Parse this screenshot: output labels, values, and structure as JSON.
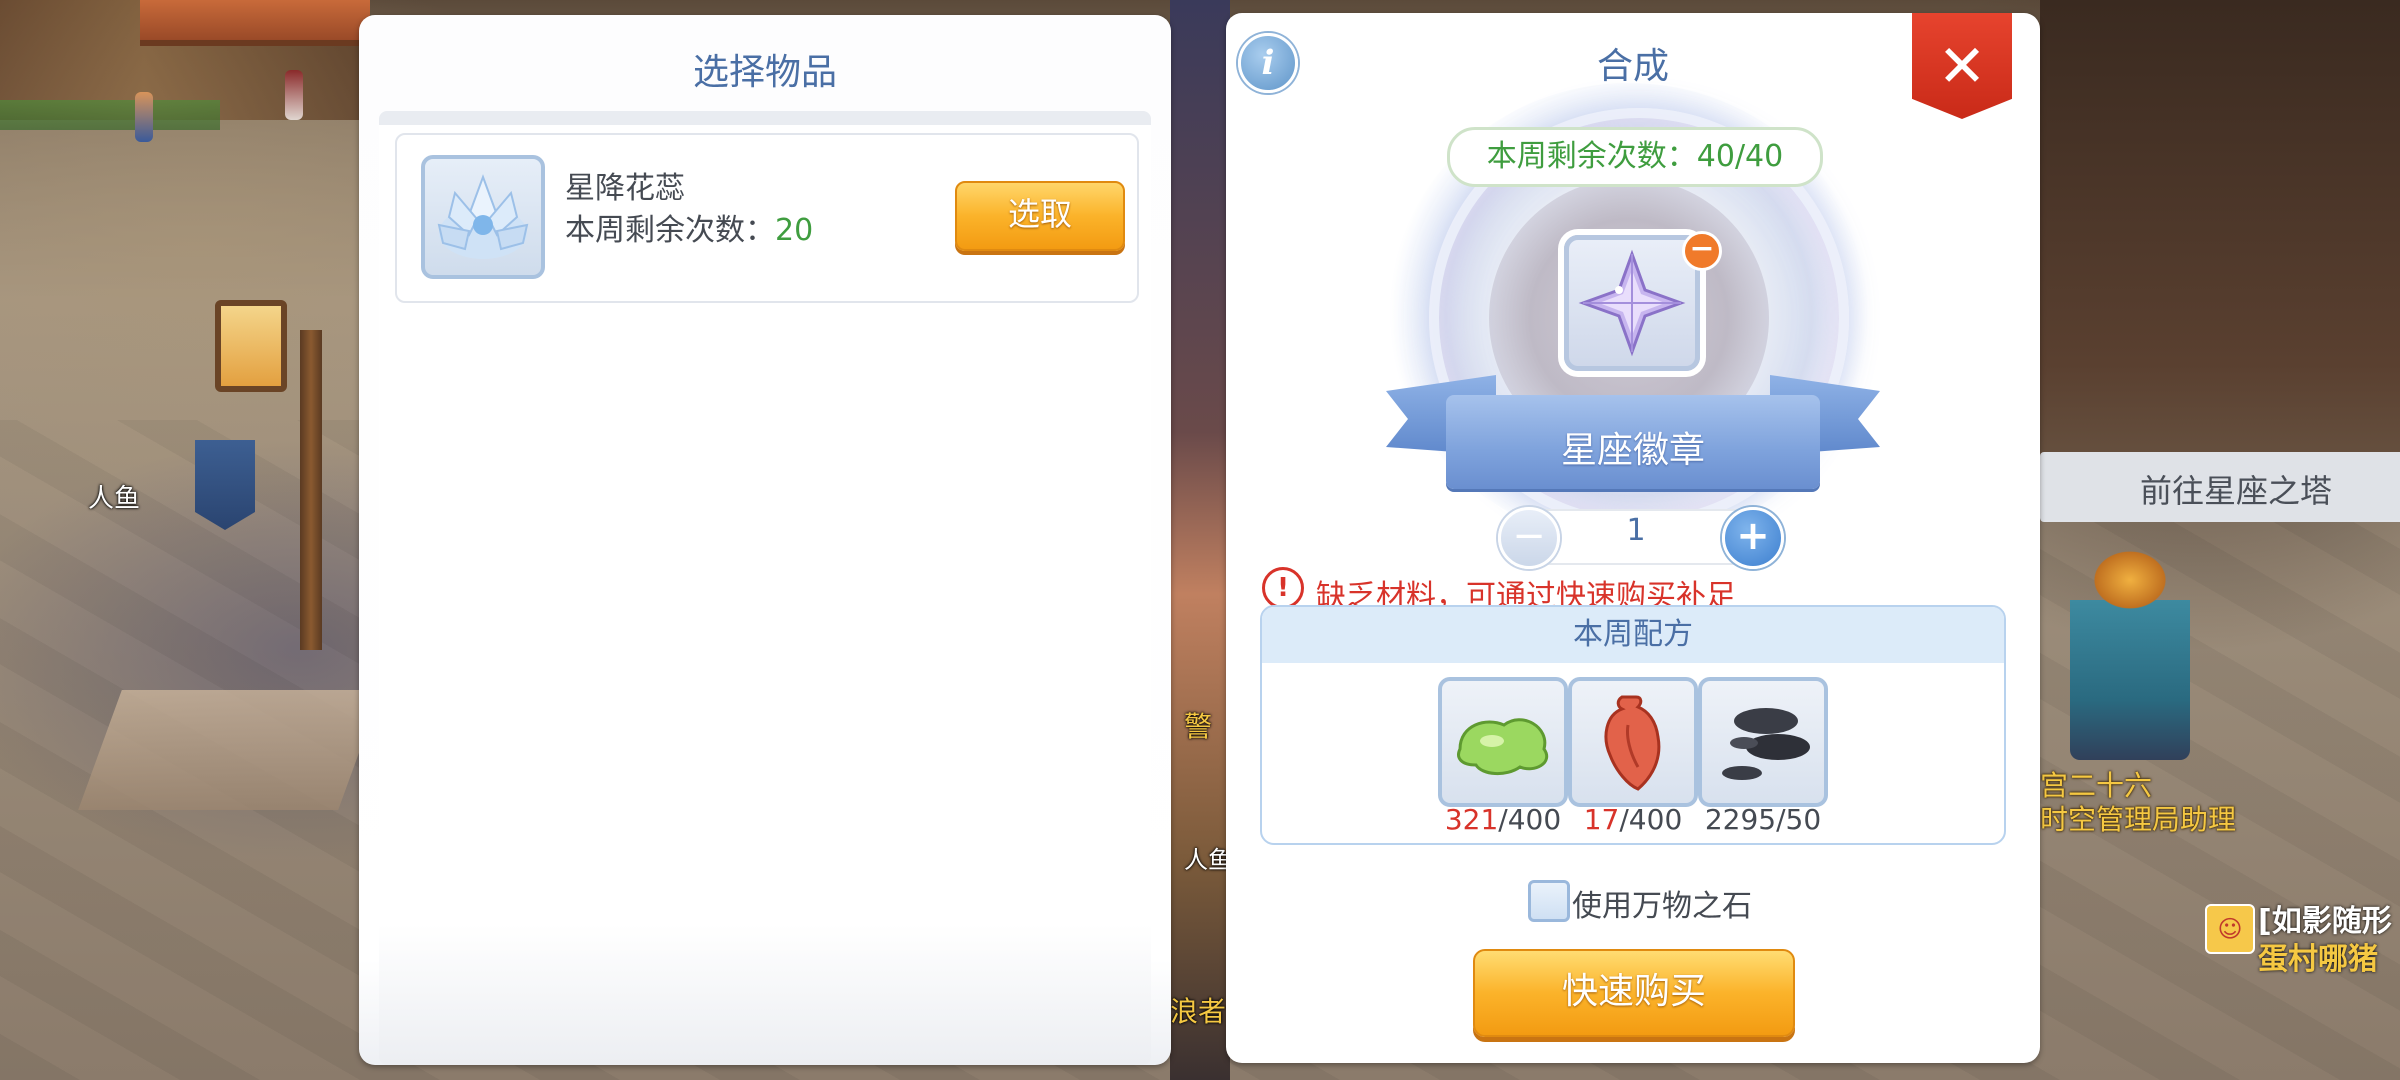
{
  "world": {
    "labels": {
      "merman": "人鱼",
      "merman_2": "人鱼",
      "npc_title": "宫二十六",
      "npc_subtitle": "时空管理局助理",
      "mid_text_1": "警",
      "mid_text_2": "浪者"
    },
    "npc_bubble": {
      "wing_icon": "wing-icon",
      "text": "前往星座之塔"
    },
    "chat": {
      "line1": "[如影随形",
      "line2": "蛋村哪猪"
    }
  },
  "select_panel": {
    "title": "选择物品",
    "items": [
      {
        "name": "星降花蕊",
        "count_label": "本周剩余次数：",
        "count_value": "20",
        "button_label": "选取",
        "icon": "crystal-flower-icon"
      }
    ]
  },
  "craft_panel": {
    "title": "合成",
    "info_label": "i",
    "close_label": "✕",
    "remaining_label": "本周剩余次数：40/40",
    "product": {
      "name": "星座徽章",
      "icon": "star-crystal-icon",
      "remove_label": "−"
    },
    "quantity": {
      "minus_label": "−",
      "value": "1",
      "plus_label": "+"
    },
    "warning": {
      "icon_label": "!",
      "text": "缺乏材料，可通过快速购买补足"
    },
    "recipe": {
      "title": "本周配方",
      "materials": [
        {
          "icon": "green-slime-icon",
          "have": "321",
          "need": "/400",
          "short": true
        },
        {
          "icon": "red-heart-icon",
          "have": "17",
          "need": "/400",
          "short": true
        },
        {
          "icon": "dark-stones-icon",
          "have": "2295",
          "need": "/50",
          "short": false
        }
      ]
    },
    "use_stone_label": "使用万物之石",
    "use_stone_checked": false,
    "buy_button_label": "快速购买"
  },
  "colors": {
    "title_blue": "#4a6fa5",
    "count_green": "#3f9d3f",
    "warn_red": "#d8332a",
    "button_orange": "#fbb32a",
    "close_red": "#c92a18"
  }
}
